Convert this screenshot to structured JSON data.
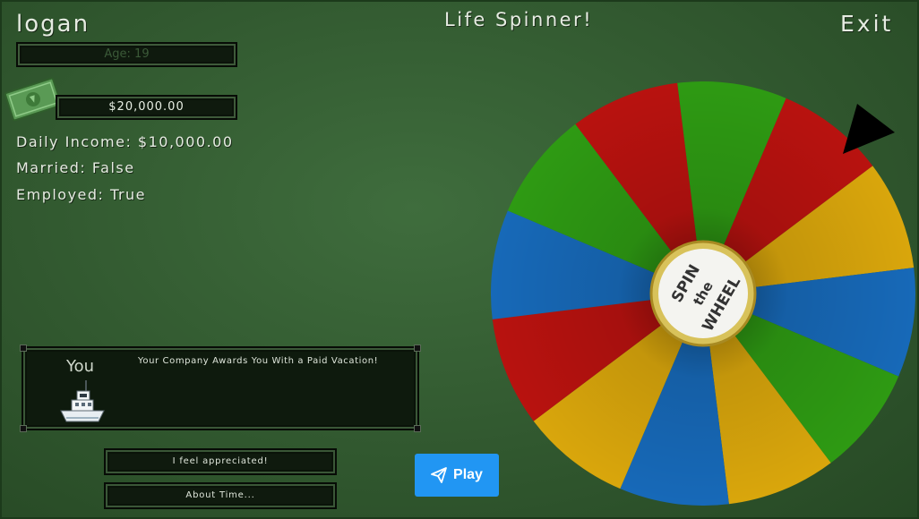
{
  "header": {
    "player_name": "logan",
    "title": "Life Spinner!",
    "exit_label": "Exit"
  },
  "stats": {
    "age_label": "Age: 19",
    "money": "$20,000.00",
    "daily_income": "Daily Income: $10,000.00",
    "married": "Married: False",
    "employed": "Employed: True"
  },
  "event": {
    "you_label": "You",
    "message": "Your Company Awards You With a Paid Vacation!"
  },
  "choices": [
    {
      "label": "I feel appreciated!"
    },
    {
      "label": "About Time..."
    }
  ],
  "play": {
    "label": "Play"
  },
  "wheel": {
    "center_text_line1": "SPIN",
    "center_text_line2": "the",
    "center_text_line3": "WHEEL",
    "segment_colors": [
      "#2e9a13",
      "#b8120f",
      "#d9a60c",
      "#1769b8",
      "#2e9a13",
      "#d9a60c",
      "#1769b8",
      "#d9a60c",
      "#b8120f",
      "#1769b8",
      "#2e9a13",
      "#b8120f"
    ]
  }
}
